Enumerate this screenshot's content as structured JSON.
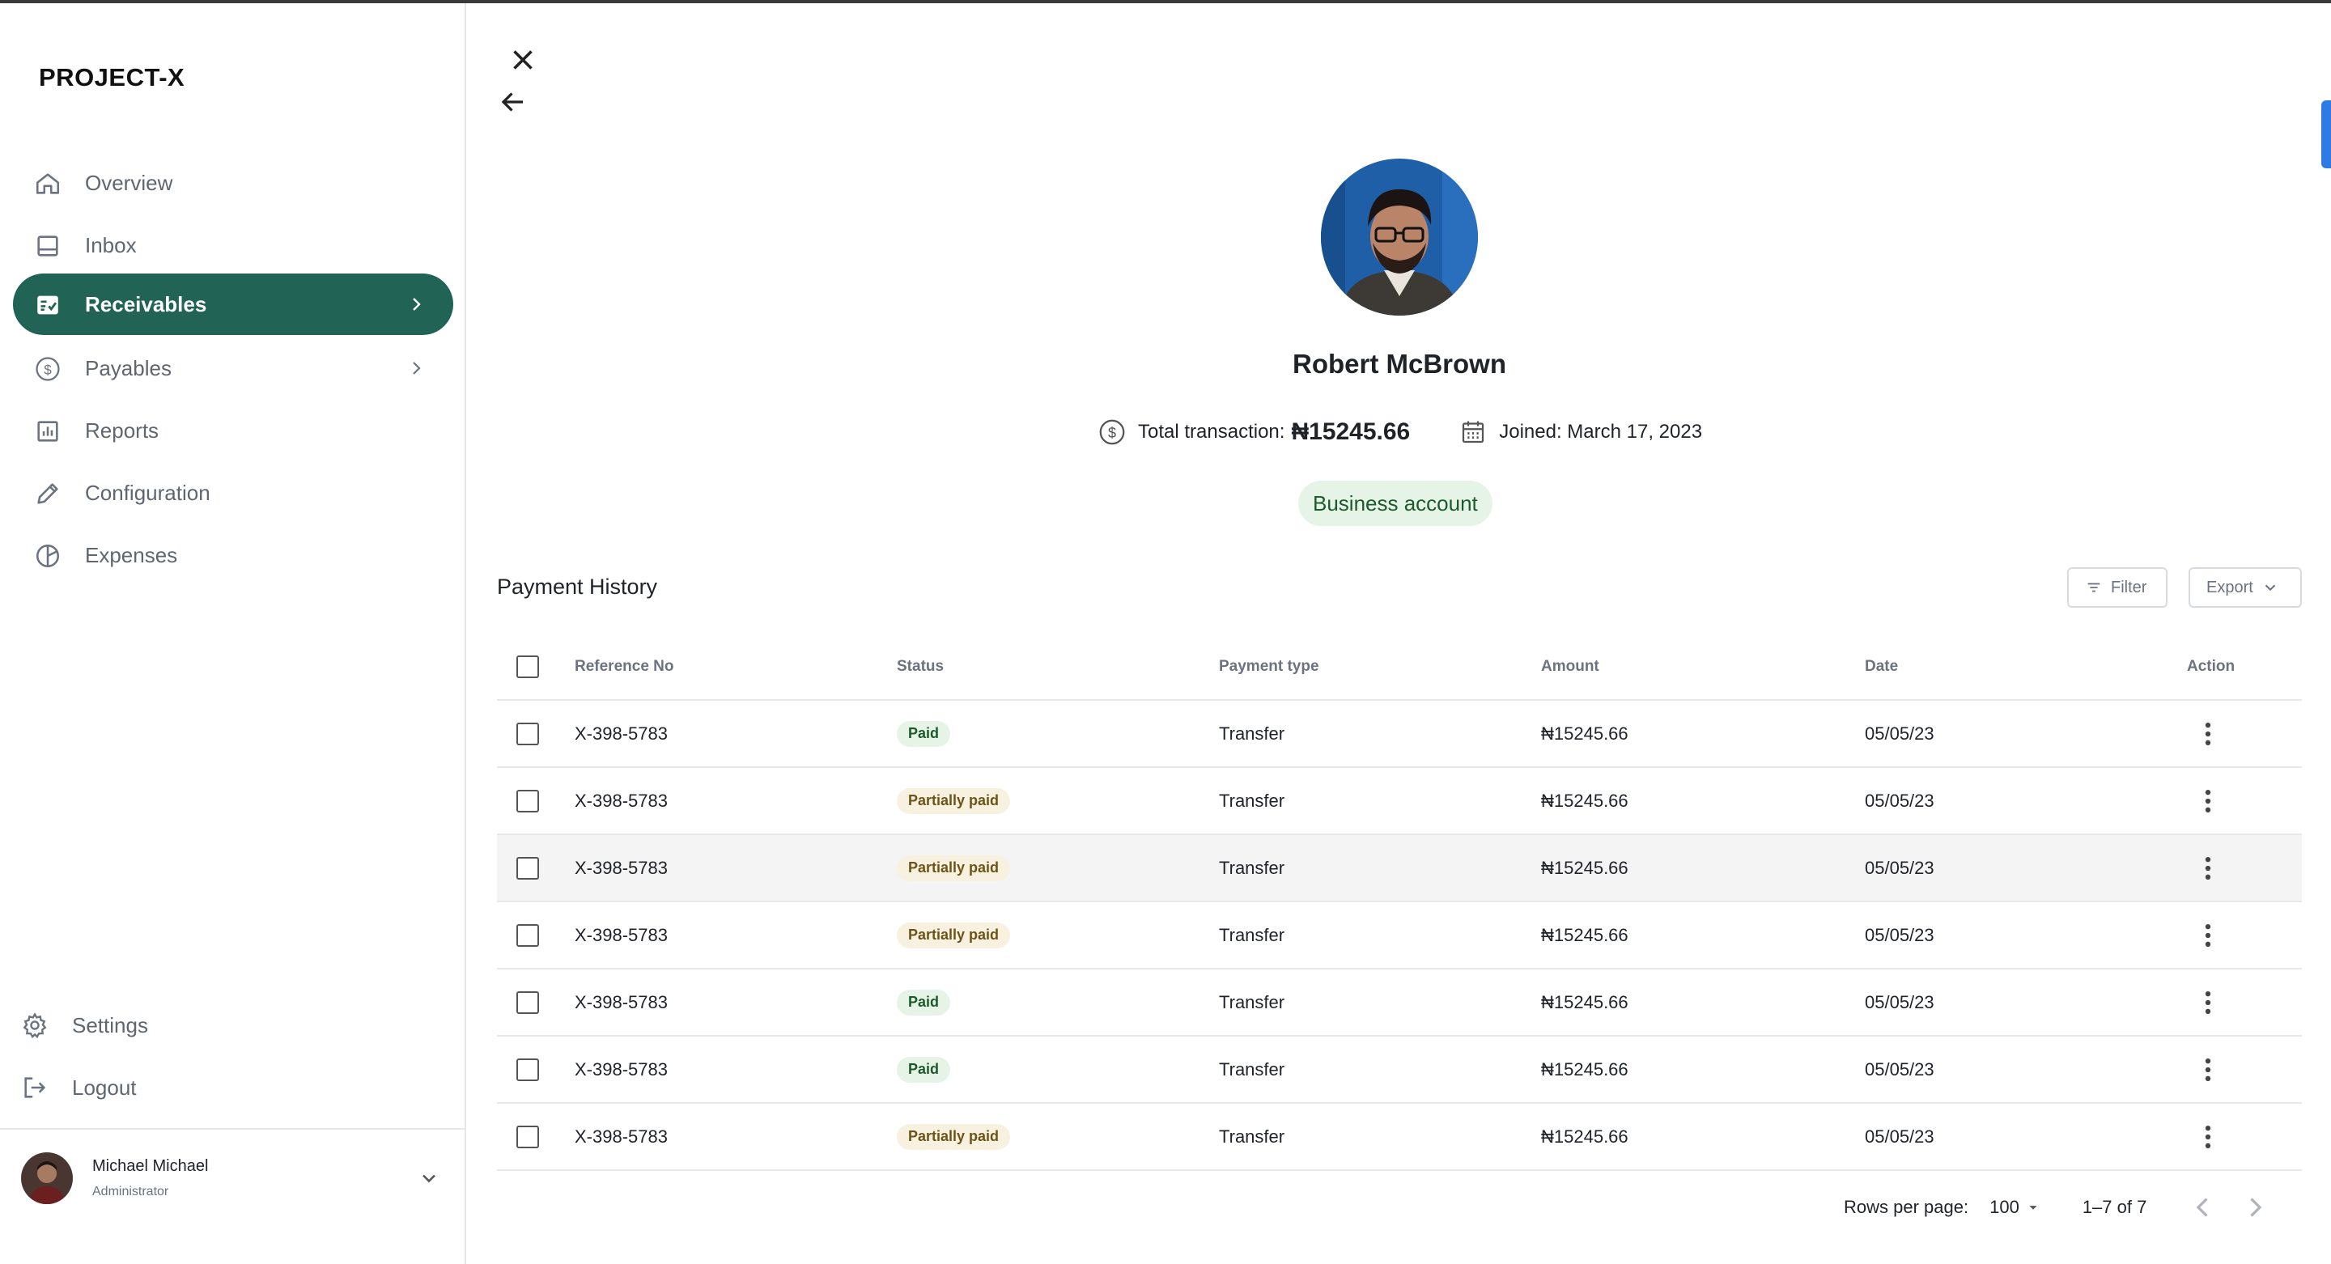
{
  "app": {
    "name": "PROJECT-X"
  },
  "sidebar": {
    "items": [
      {
        "label": "Overview",
        "icon": "home-icon"
      },
      {
        "label": "Inbox",
        "icon": "inbox-icon"
      },
      {
        "label": "Receivables",
        "icon": "receivables-icon",
        "active": true
      },
      {
        "label": "Payables",
        "icon": "dollar-circle-icon"
      },
      {
        "label": "Reports",
        "icon": "bar-chart-icon"
      },
      {
        "label": "Configuration",
        "icon": "pencil-icon"
      },
      {
        "label": "Expenses",
        "icon": "pie-chart-icon"
      }
    ],
    "bottom": [
      {
        "label": "Settings",
        "icon": "gear-icon"
      },
      {
        "label": "Logout",
        "icon": "logout-icon"
      }
    ],
    "user": {
      "name": "Michael Michael",
      "role": "Administrator"
    }
  },
  "profile": {
    "name": "Robert McBrown",
    "total_label": "Total transaction:",
    "total_value": "₦15245.66",
    "joined": "Joined: March 17, 2023",
    "badge": "Business account"
  },
  "payment_history": {
    "title": "Payment History",
    "filter_label": "Filter",
    "export_label": "Export",
    "columns": [
      "Reference No",
      "Status",
      "Payment type",
      "Amount",
      "Date",
      "Action"
    ],
    "rows": [
      {
        "ref": "X-398-5783",
        "status": "Paid",
        "status_kind": "paid",
        "type": "Transfer",
        "amount": "₦15245.66",
        "date": "05/05/23"
      },
      {
        "ref": "X-398-5783",
        "status": "Partially paid",
        "status_kind": "partial",
        "type": "Transfer",
        "amount": "₦15245.66",
        "date": "05/05/23"
      },
      {
        "ref": "X-398-5783",
        "status": "Partially paid",
        "status_kind": "partial",
        "type": "Transfer",
        "amount": "₦15245.66",
        "date": "05/05/23",
        "hover": true
      },
      {
        "ref": "X-398-5783",
        "status": "Partially paid",
        "status_kind": "partial",
        "type": "Transfer",
        "amount": "₦15245.66",
        "date": "05/05/23"
      },
      {
        "ref": "X-398-5783",
        "status": "Paid",
        "status_kind": "paid",
        "type": "Transfer",
        "amount": "₦15245.66",
        "date": "05/05/23"
      },
      {
        "ref": "X-398-5783",
        "status": "Paid",
        "status_kind": "paid",
        "type": "Transfer",
        "amount": "₦15245.66",
        "date": "05/05/23"
      },
      {
        "ref": "X-398-5783",
        "status": "Partially paid",
        "status_kind": "partial",
        "type": "Transfer",
        "amount": "₦15245.66",
        "date": "05/05/23"
      }
    ],
    "pagination": {
      "rows_per_page_label": "Rows per page:",
      "rows_per_page": "100",
      "range": "1–7 of 7"
    }
  },
  "colors": {
    "accent": "#216355",
    "paid_bg": "#e6f4e8",
    "partial_bg": "#f8f1e0",
    "scroll_accent": "#2f7be6"
  }
}
